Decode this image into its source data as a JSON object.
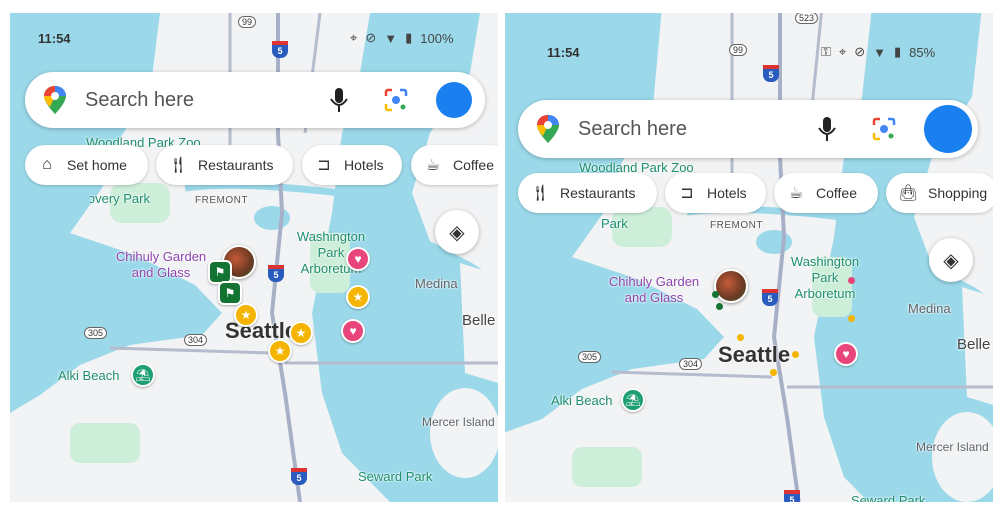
{
  "colors": {
    "water": "#9bd9ea",
    "land": "#f2f3f4",
    "park": "#cdeed8",
    "accent": "#1a80f0",
    "star": "#f4b400",
    "heart": "#e8457a",
    "flag": "#137333"
  },
  "left": {
    "status": {
      "time": "11:54",
      "battery": "100%",
      "icons": [
        "location-icon",
        "vibrate-off-icon",
        "wifi-icon",
        "battery-icon"
      ]
    },
    "search": {
      "placeholder": "Search here"
    },
    "chips": [
      {
        "label": "Set home",
        "icon": "home-icon"
      },
      {
        "label": "Restaurants",
        "icon": "restaurant-icon"
      },
      {
        "label": "Hotels",
        "icon": "hotel-icon"
      },
      {
        "label": "Coffee",
        "icon": "coffee-icon"
      }
    ],
    "map": {
      "labels": [
        "Woodland Park Zoo",
        "Discovery Park",
        "FREMONT",
        "Washington Park Arboretum",
        "Chihuly Garden and Glass",
        "Medina",
        "Seattle",
        "Belle",
        "Alki Beach",
        "Mercer Island",
        "Seward Park"
      ],
      "shields": [
        "99",
        "5",
        "5",
        "305",
        "304",
        "5"
      ]
    }
  },
  "right": {
    "status": {
      "time": "11:54",
      "battery": "85%",
      "icons": [
        "key-icon",
        "location-icon",
        "vibrate-off-icon",
        "wifi-icon",
        "battery-icon"
      ]
    },
    "search": {
      "placeholder": "Search here"
    },
    "chips": [
      {
        "label": "Restaurants",
        "icon": "restaurant-icon"
      },
      {
        "label": "Hotels",
        "icon": "hotel-icon"
      },
      {
        "label": "Coffee",
        "icon": "coffee-icon"
      },
      {
        "label": "Shopping",
        "icon": "shopping-bag-icon"
      }
    ],
    "map": {
      "labels": [
        "Woodland Park Zoo",
        "Park",
        "FREMONT",
        "Washington Park Arboretum",
        "Chihuly Garden and Glass",
        "Medina",
        "Seattle",
        "Belle",
        "Alki Beach",
        "Mercer Island",
        "Seward Park"
      ],
      "shields": [
        "523",
        "99",
        "5",
        "5",
        "305",
        "304",
        "5"
      ]
    }
  }
}
